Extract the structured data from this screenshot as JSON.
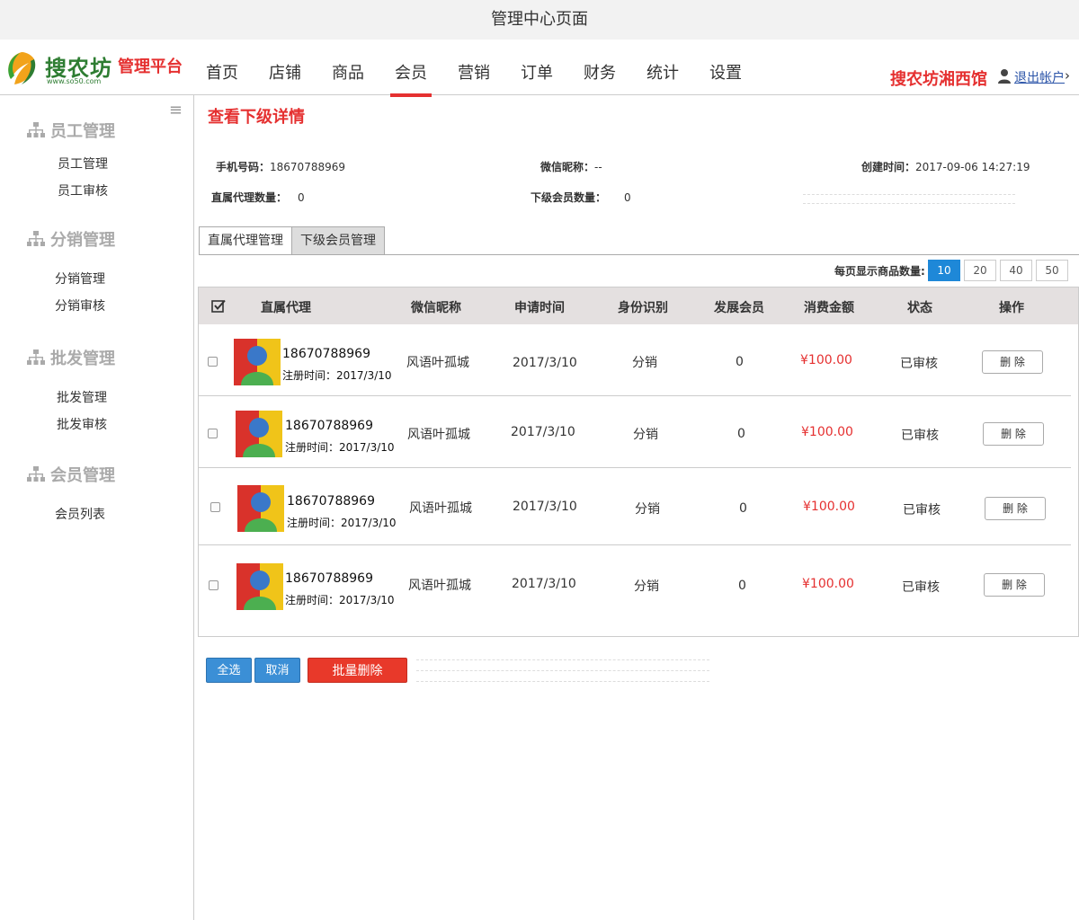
{
  "window": {
    "title": "管理中心页面"
  },
  "brand": {
    "logo_text": "搜农坊",
    "logo_url": "www.so50.com",
    "platform": "管理平台"
  },
  "nav": {
    "items": [
      {
        "label": "首页"
      },
      {
        "label": "店铺"
      },
      {
        "label": "商品"
      },
      {
        "label": "会员",
        "active": true
      },
      {
        "label": "营销"
      },
      {
        "label": "订单"
      },
      {
        "label": "财务"
      },
      {
        "label": "统计"
      },
      {
        "label": "设置"
      }
    ],
    "store_name": "搜农坊湘西馆",
    "logout": "退出帐户",
    "logout_arrow": "›"
  },
  "sidebar": {
    "menu_icon": "≡",
    "groups": [
      {
        "title": "员工管理",
        "links": [
          "员工管理",
          "员工审核"
        ]
      },
      {
        "title": "分销管理",
        "links": [
          "分销管理",
          "分销审核"
        ]
      },
      {
        "title": "批发管理",
        "links": [
          "批发管理",
          "批发审核"
        ]
      },
      {
        "title": "会员管理",
        "links": [
          "会员列表"
        ]
      }
    ]
  },
  "page": {
    "title": "查看下级详情",
    "info": {
      "phone_label": "手机号码：",
      "phone": "18670788969",
      "nick_label": "微信昵称：",
      "nick": "--",
      "created_label": "创建时间：",
      "created": "2017-09-06 14:27:19",
      "direct_label": "直属代理数量：",
      "direct": "0",
      "sub_label": "下级会员数量：",
      "sub": "0"
    },
    "tabs": [
      "直属代理管理",
      "下级会员管理"
    ],
    "per_page": {
      "label": "每页显示商品数量:",
      "options": [
        "10",
        "20",
        "40",
        "50"
      ],
      "selected": "10"
    }
  },
  "table": {
    "headers": [
      "直属代理",
      "微信昵称",
      "申请时间",
      "身份识别",
      "发展会员",
      "消费金额",
      "状态",
      "操作"
    ],
    "rows": [
      {
        "phone": "18670788969",
        "reg": "注册时间：2017/3/10",
        "nick": "风语叶孤城",
        "date": "2017/3/10",
        "role": "分销",
        "members": "0",
        "amount": "¥100.00",
        "status": "已审核",
        "action": "删 除"
      },
      {
        "phone": "18670788969",
        "reg": "注册时间：2017/3/10",
        "nick": "风语叶孤城",
        "date": "2017/3/10",
        "role": "分销",
        "members": "0",
        "amount": "¥100.00",
        "status": "已审核",
        "action": "删 除"
      },
      {
        "phone": "18670788969",
        "reg": "注册时间：2017/3/10",
        "nick": "风语叶孤城",
        "date": "2017/3/10",
        "role": "分销",
        "members": "0",
        "amount": "¥100.00",
        "status": "已审核",
        "action": "删 除"
      },
      {
        "phone": "18670788969",
        "reg": "注册时间：2017/3/10",
        "nick": "风语叶孤城",
        "date": "2017/3/10",
        "role": "分销",
        "members": "0",
        "amount": "¥100.00",
        "status": "已审核",
        "action": "删 除"
      }
    ]
  },
  "actions": {
    "select_all": "全选",
    "cancel": "取消",
    "batch_delete": "批量删除"
  },
  "colors": {
    "accent": "#e53030",
    "primary": "#1e88d8",
    "header_bg": "#e4e0e0"
  }
}
